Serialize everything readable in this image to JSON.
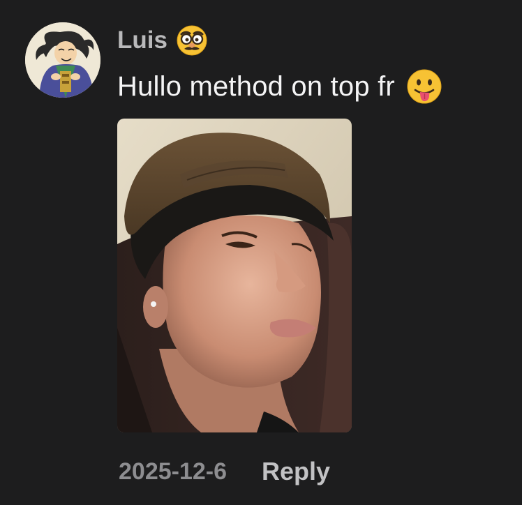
{
  "comment": {
    "author": "Luis",
    "author_badge_icon": "nerd-disguise-face-emoji-icon",
    "text": "Hullo method on top fr",
    "text_emoji_icon": "face-with-tongue-emoji-icon",
    "attached_image": "selfie-photo",
    "date": "2025-12-6",
    "reply_label": "Reply"
  },
  "colors": {
    "background": "#1d1d1e",
    "username": "#b9b9bb",
    "comment_text": "#f4f4f5",
    "date": "#8d8d90",
    "reply": "#c2c2c4"
  }
}
